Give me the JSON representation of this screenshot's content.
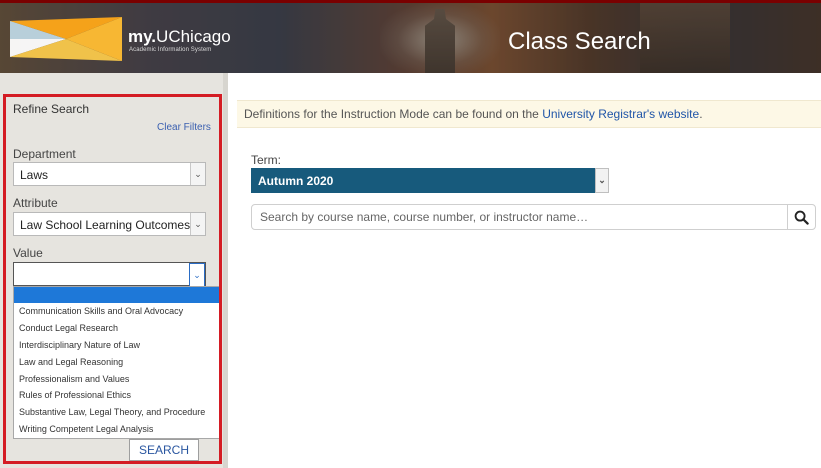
{
  "header": {
    "brand_bold": "my.",
    "brand_rest": "UChicago",
    "tagline": "Academic Information System",
    "page_title": "Class Search",
    "accent_color": "#7a0000"
  },
  "sidebar": {
    "title": "Refine Search",
    "clear_filters": "Clear Filters",
    "department": {
      "label": "Department",
      "value": "Laws"
    },
    "attribute": {
      "label": "Attribute",
      "value": "Law School Learning Outcomes"
    },
    "value": {
      "label": "Value",
      "selected": "",
      "options": [
        "",
        "Communication Skills and Oral Advocacy",
        "Conduct Legal Research",
        "Interdisciplinary Nature of Law",
        "Law and Legal Reasoning",
        "Professionalism and Values",
        "Rules of Professional Ethics",
        "Substantive Law, Legal Theory, and Procedure",
        "Writing Competent Legal Analysis"
      ]
    },
    "search_button": "SEARCH"
  },
  "main": {
    "notice_prefix": "Definitions for the Instruction Mode can be found on the ",
    "notice_link": "University Registrar's website",
    "notice_suffix": ".",
    "term_label": "Term:",
    "term_value": "Autumn 2020",
    "search_placeholder": "Search by course name, course number, or instructor name…"
  },
  "icons": {
    "dropdown_arrow": "chevron-down-icon",
    "search": "search-icon",
    "logo": "uchicago-logo"
  }
}
